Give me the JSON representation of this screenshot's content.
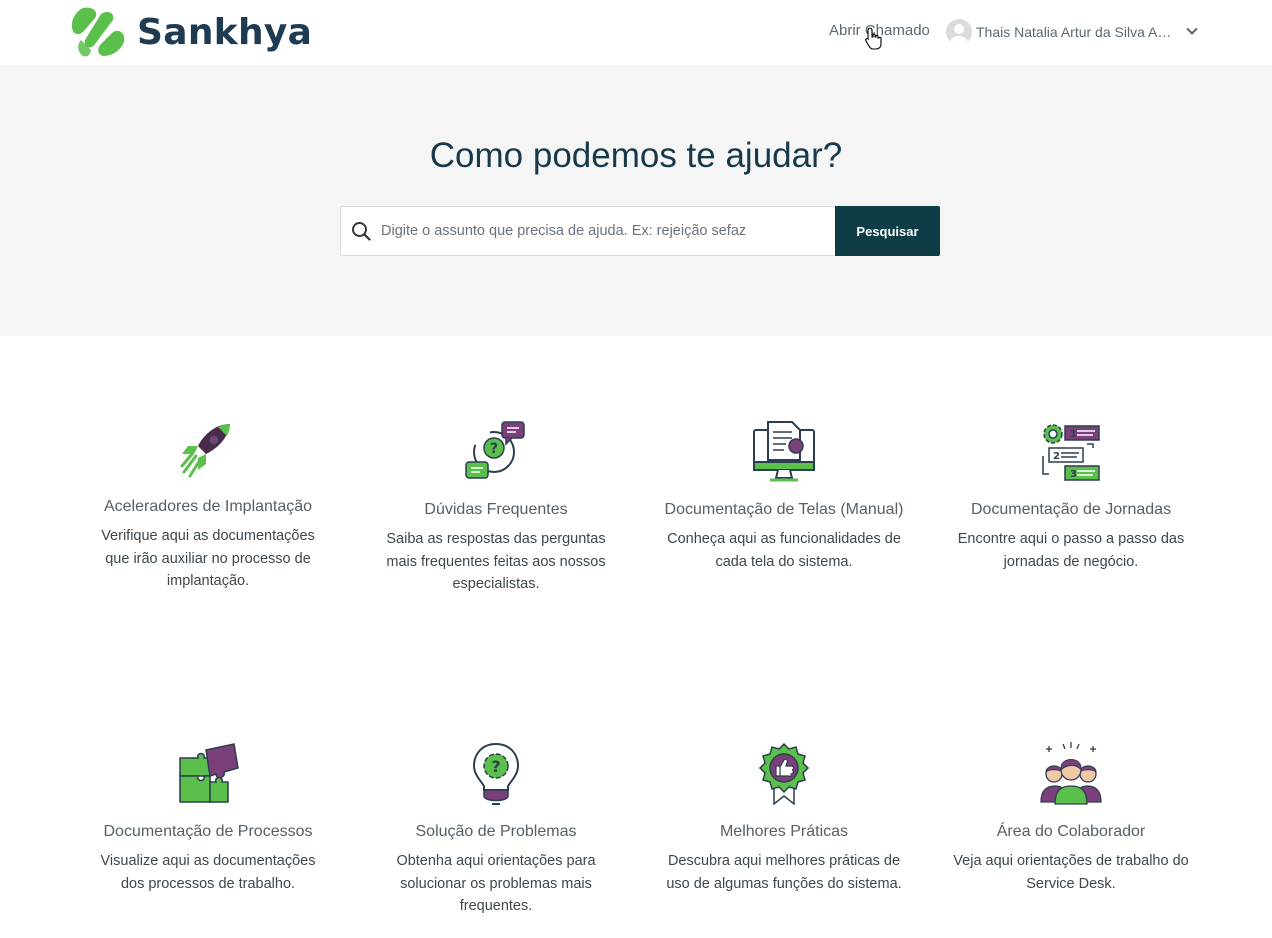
{
  "header": {
    "brand": "Sankhya",
    "colors": {
      "brand_green": "#5bbf4b",
      "brand_navy": "#1f3b52",
      "accent": "#0e3d48"
    },
    "nav_link": "Abrir Chamado",
    "user_name": "Thais Natalia Artur da Silva Ar...",
    "user_icon": "avatar-icon",
    "dropdown_icon": "chevron-down-icon"
  },
  "hero": {
    "title": "Como podemos te ajudar?",
    "search": {
      "placeholder": "Digite o assunto que precisa de ajuda. Ex: rejeição sefaz",
      "value": "",
      "button_label": "Pesquisar",
      "icon": "search-icon"
    }
  },
  "categories": [
    {
      "icon": "rocket-icon",
      "title": "Aceleradores de Implantação",
      "description": "Verifique aqui as documentações que irão auxiliar no processo de implantação."
    },
    {
      "icon": "question-chat-icon",
      "title": "Dúvidas Frequentes",
      "description": "Saiba as respostas das perguntas mais frequentes feitas aos nossos especialistas."
    },
    {
      "icon": "monitor-document-icon",
      "title": "Documentação de Telas (Manual)",
      "description": "Conheça aqui as funcionalidades de cada tela do sistema."
    },
    {
      "icon": "workflow-steps-icon",
      "title": "Documentação de Jornadas",
      "description": "Encontre aqui o passo a passo das jornadas de negócio."
    },
    {
      "icon": "puzzle-icon",
      "title": "Documentação de Processos",
      "description": "Visualize aqui as documentações dos processos de trabalho."
    },
    {
      "icon": "lightbulb-gear-icon",
      "title": "Solução de Problemas",
      "description": "Obtenha aqui orientações para solucionar os problemas mais frequentes."
    },
    {
      "icon": "badge-thumbs-up-icon",
      "title": "Melhores Práticas",
      "description": "Descubra aqui melhores práticas de uso de algumas funções do sistema."
    },
    {
      "icon": "team-icon",
      "title": "Área do Colaborador",
      "description": "Veja aqui orientações de trabalho do Service Desk."
    }
  ]
}
